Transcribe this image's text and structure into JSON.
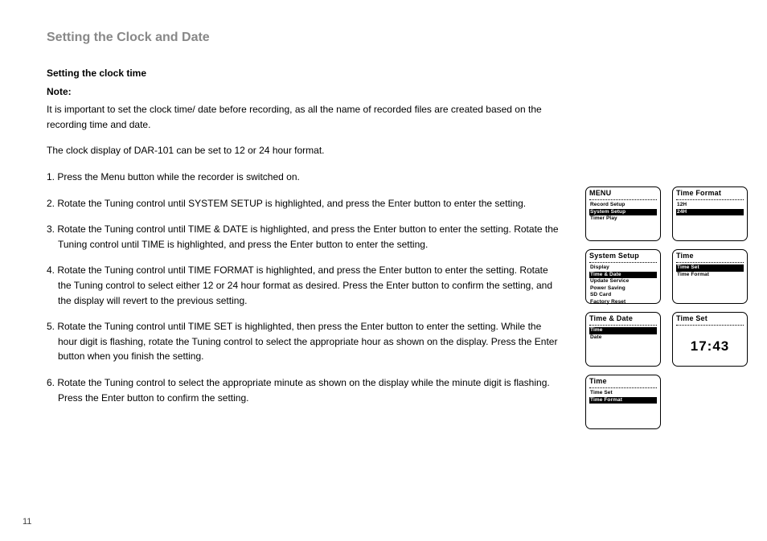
{
  "title": "Setting the Clock and Date",
  "sub1": "Setting the clock time",
  "note_label": "Note:",
  "intro1": "It is important to set the clock time/ date before recording, as all the name of  recorded files are created based on the recording time and date.",
  "intro2": "The clock display of DAR-101 can be set to 12 or 24 hour format.",
  "step1": "1. Press the Menu button while the recorder is switched on.",
  "step2": "2. Rotate the Tuning control until SYSTEM SETUP is highlighted, and press the Enter button to enter the setting.",
  "step3": "3. Rotate the Tuning control until TIME & DATE is highlighted, and press the Enter button to enter the setting. Rotate the Tuning control until TIME is highlighted, and press the Enter button to enter the setting.",
  "step4": "4. Rotate the Tuning control until TIME FORMAT is highlighted, and press the Enter button to enter the setting. Rotate the Tuning control to select either 12 or 24 hour format as desired. Press the Enter button to confirm the setting, and the display will revert to the previous setting.",
  "step5": "5. Rotate the Tuning control until TIME SET is highlighted, then press the Enter button to enter the setting. While the hour digit is flashing, rotate the Tuning control to select the appropriate hour as shown on the display. Press the Enter button when you finish the setting.",
  "step6": "6. Rotate the Tuning control to select the appropriate minute as shown on the display while the minute digit is flashing. Press the Enter button to confirm the setting.",
  "page_number": "11",
  "lcd": {
    "menu": {
      "title": "MENU",
      "items": [
        "Record Setup",
        "System Setup",
        "Timer Play"
      ],
      "selected": 1
    },
    "system_setup": {
      "title": "System Setup",
      "items": [
        "Display",
        "Time & Date",
        "Update Service",
        "Power Saving",
        "SD Card",
        "Factory Reset"
      ],
      "selected": 1
    },
    "time_date": {
      "title": "Time & Date",
      "items": [
        "Time",
        "Date"
      ],
      "selected": 0
    },
    "time_a": {
      "title": "Time",
      "items": [
        "Time Set",
        "Time Format"
      ],
      "selected": 1
    },
    "time_format": {
      "title": "Time Format",
      "items": [
        "12H",
        "24H"
      ],
      "selected": 1
    },
    "time_b": {
      "title": "Time",
      "items": [
        "Time Set",
        "Time Format"
      ],
      "selected": 0
    },
    "time_set": {
      "title": "Time Set",
      "value": "17:43"
    }
  }
}
